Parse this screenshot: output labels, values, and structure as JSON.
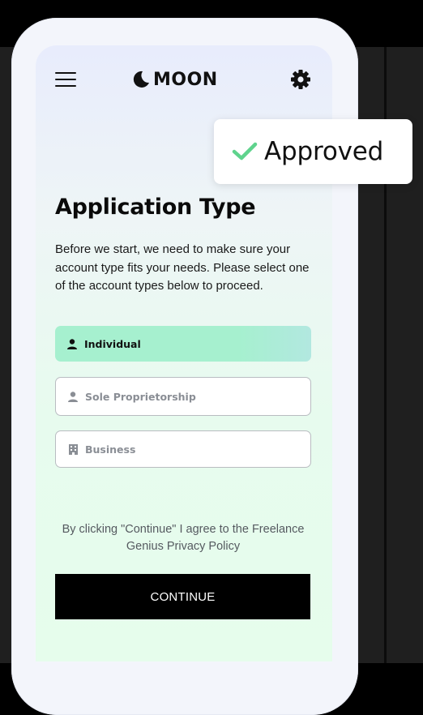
{
  "header": {
    "menu_icon": "hamburger-menu-icon",
    "logo_text": "MOON",
    "logo_icon": "crescent-moon-icon",
    "settings_icon": "gear-icon"
  },
  "page": {
    "title": "Application Type",
    "description": "Before we start, we need to make sure your account type fits your needs. Please select one of the account types below to proceed."
  },
  "options": [
    {
      "label": "Individual",
      "icon": "person-icon",
      "selected": true
    },
    {
      "label": "Sole Proprietorship",
      "icon": "person-icon",
      "selected": false
    },
    {
      "label": "Business",
      "icon": "building-icon",
      "selected": false
    }
  ],
  "agreement": {
    "text": "By clicking \"Continue\" I agree to the Freelance Genius Privacy Policy"
  },
  "continue_button": {
    "label": "CONTINUE"
  },
  "toast": {
    "text": "Approved",
    "icon": "checkmark-icon"
  },
  "colors": {
    "selected_option": "#a6f0cf",
    "check": "#5fd38d",
    "button_bg": "#000000"
  }
}
